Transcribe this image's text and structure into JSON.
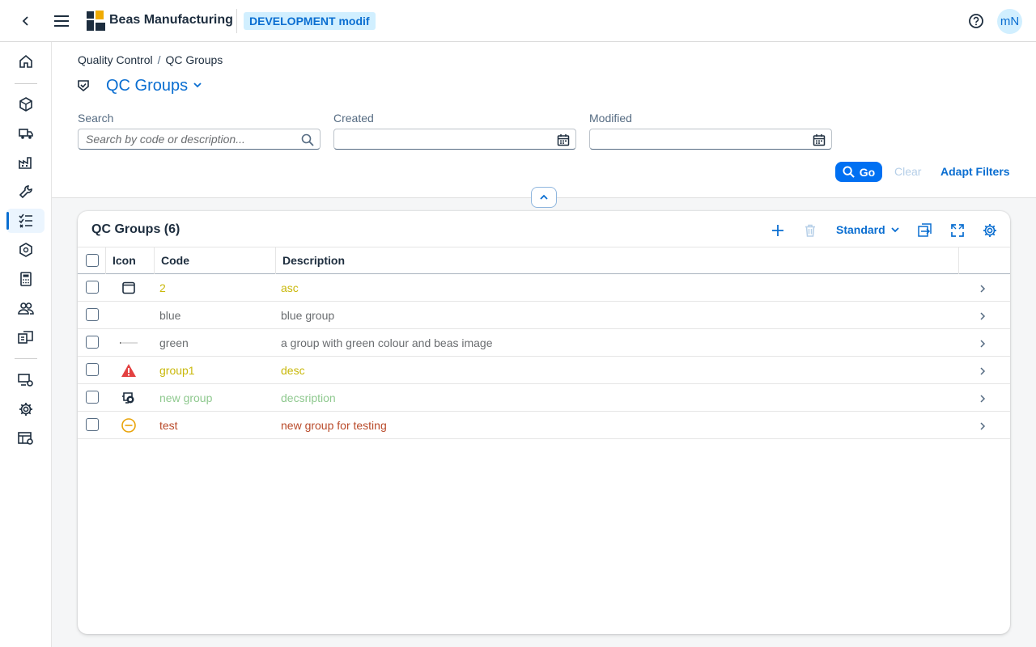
{
  "shell": {
    "brand": "Beas Manufacturing",
    "environment": "DEVELOPMENT modif",
    "avatar_initials": "mN"
  },
  "breadcrumb": {
    "parent": "Quality Control",
    "current": "QC Groups"
  },
  "page": {
    "title": "QC Groups"
  },
  "filters": {
    "search_label": "Search",
    "search_placeholder": "Search by code or description...",
    "created_label": "Created",
    "modified_label": "Modified",
    "go_label": "Go",
    "clear_label": "Clear",
    "adapt_label": "Adapt Filters"
  },
  "table": {
    "title": "QC Groups (6)",
    "variant": "Standard",
    "columns": [
      "Icon",
      "Code",
      "Description"
    ],
    "rows": [
      {
        "icon": "page-frame-icon",
        "code": "2",
        "description": "asc",
        "color": "#c9b80a"
      },
      {
        "icon": "",
        "code": "blue",
        "description": "blue group",
        "color": "#6a6d70"
      },
      {
        "icon": "beas-image-icon",
        "code": "green",
        "description": "a group with green colour and beas image",
        "color": "#6a6d70"
      },
      {
        "icon": "warning-triangle-icon",
        "code": "group1",
        "description": "desc",
        "color": "#c9b80a"
      },
      {
        "icon": "car-rental-icon",
        "code": "new group",
        "description": "decsription",
        "color": "#8fc98f"
      },
      {
        "icon": "minus-circle-icon",
        "code": "test",
        "description": "new group for testing",
        "color": "#b94a2a"
      }
    ]
  },
  "colors": {
    "accent": "#0a6ed1",
    "warning": "#e34141",
    "minus": "#e9a40a"
  }
}
